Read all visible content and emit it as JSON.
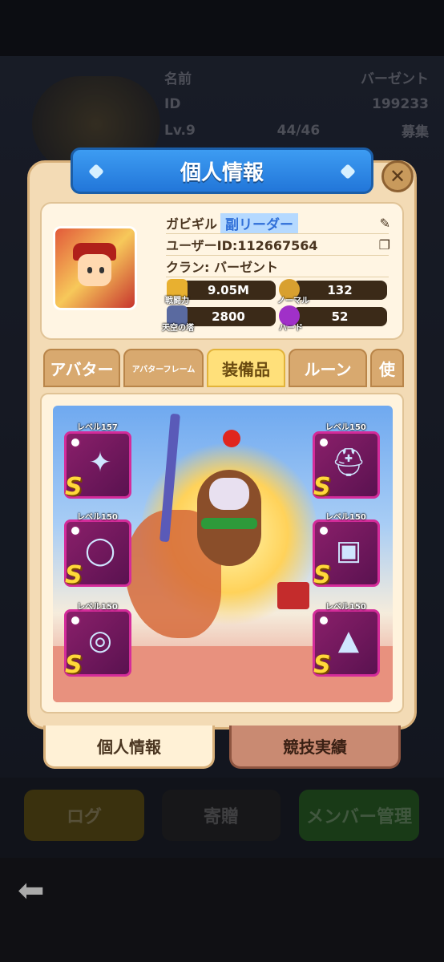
{
  "background": {
    "name_label": "名前",
    "name_value": "バーゼント",
    "id_label": "ID",
    "id_value": "199233",
    "level": "Lv.9",
    "members": "44/46",
    "recruit": "募集",
    "buttons": {
      "log": "ログ",
      "donate": "寄贈",
      "member_manage": "メンバー管理"
    }
  },
  "modal": {
    "title": "個人情報",
    "profile": {
      "name": "ガビギル",
      "role": "副リーダー",
      "user_id": "ユーザーID:112667564",
      "clan": "クラン: バーゼント",
      "stats": {
        "power_label": "戦闘力",
        "power": "9.05M",
        "normal_label": "ノーマル",
        "normal": "132",
        "tower_label": "天空の塔",
        "tower": "2800",
        "hard_label": "ハード",
        "hard": "52"
      }
    },
    "tabs": [
      "アバター",
      "アバターフレーム",
      "装備品",
      "ルーン",
      "使"
    ],
    "active_tab": "装備品",
    "equipment": [
      {
        "level": "レベル157",
        "grade": "S",
        "icon": "shuriken-icon"
      },
      {
        "level": "レベル150",
        "grade": "S",
        "icon": "helmet-icon"
      },
      {
        "level": "レベル150",
        "grade": "S",
        "icon": "necklace-icon"
      },
      {
        "level": "レベル150",
        "grade": "S",
        "icon": "armor-icon"
      },
      {
        "level": "レベル150",
        "grade": "S",
        "icon": "ring-icon"
      },
      {
        "level": "レベル150",
        "grade": "S",
        "icon": "boots-icon"
      }
    ],
    "bottom_tabs": {
      "personal": "個人情報",
      "arena": "競技実績"
    }
  },
  "colors": {
    "title_banner": "#2276d9",
    "active_tab": "#ffe07a",
    "slot": "#8a1f6a",
    "grade_s": "#ffd83a"
  }
}
